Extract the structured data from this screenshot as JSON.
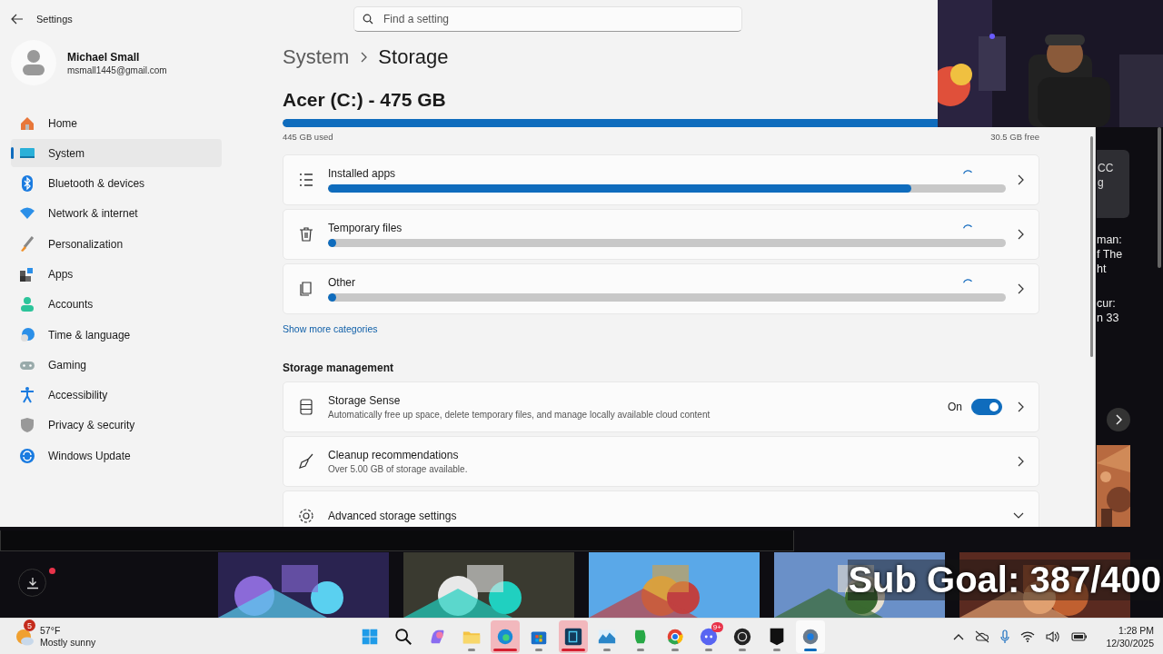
{
  "settings_window": {
    "title": "Settings",
    "search": {
      "placeholder": "Find a setting"
    },
    "account": {
      "name": "Michael Small",
      "email": "msmall1445@gmail.com"
    },
    "sidebar": {
      "items": [
        {
          "label": "Home",
          "selected": false
        },
        {
          "label": "System",
          "selected": true
        },
        {
          "label": "Bluetooth & devices",
          "selected": false
        },
        {
          "label": "Network & internet",
          "selected": false
        },
        {
          "label": "Personalization",
          "selected": false
        },
        {
          "label": "Apps",
          "selected": false
        },
        {
          "label": "Accounts",
          "selected": false
        },
        {
          "label": "Time & language",
          "selected": false
        },
        {
          "label": "Gaming",
          "selected": false
        },
        {
          "label": "Accessibility",
          "selected": false
        },
        {
          "label": "Privacy & security",
          "selected": false
        },
        {
          "label": "Windows Update",
          "selected": false
        }
      ]
    },
    "breadcrumb": [
      "System",
      "Storage"
    ],
    "drive": {
      "title": "Acer (C:) - 475 GB",
      "level": 0.937,
      "used": "445 GB used",
      "free": "30.5 GB free"
    },
    "categories": [
      {
        "label": "Installed apps",
        "level": 0.86
      },
      {
        "label": "Temporary files",
        "level": 0.012
      },
      {
        "label": "Other",
        "level": 0.012
      }
    ],
    "show_more": "Show more categories",
    "management": {
      "heading": "Storage management",
      "items": [
        {
          "kind": "toggle",
          "title": "Storage Sense",
          "subtitle": "Automatically free up space, delete temporary files, and manage locally available cloud content",
          "state_label": "On",
          "on": true
        },
        {
          "kind": "link",
          "title": "Cleanup recommendations",
          "subtitle": "Over 5.00 GB of storage available."
        },
        {
          "kind": "expander",
          "title": "Advanced storage settings"
        }
      ]
    }
  },
  "background_app": {
    "card_lines": [
      "CC",
      "g"
    ],
    "text_blocks": [
      {
        "lines": [
          "man:",
          "f The",
          "ht"
        ]
      },
      {
        "lines": [
          "cur:",
          "n 33"
        ]
      }
    ]
  },
  "overlay": {
    "sub_goal": "Sub Goal: 387/400"
  },
  "taskbar": {
    "weather": {
      "badge": "5",
      "temperature": "57°F",
      "condition": "Mostly sunny"
    },
    "apps": [
      {
        "running": false,
        "active": false,
        "highlighted": false
      },
      {
        "running": false,
        "active": false,
        "highlighted": false
      },
      {
        "running": false,
        "active": false,
        "highlighted": false
      },
      {
        "running": true,
        "active": false,
        "highlighted": false
      },
      {
        "running": true,
        "active": false,
        "highlighted": true
      },
      {
        "running": true,
        "active": false,
        "highlighted": false
      },
      {
        "running": true,
        "active": false,
        "highlighted": true
      },
      {
        "running": true,
        "active": false,
        "highlighted": false
      },
      {
        "running": true,
        "active": false,
        "highlighted": false
      },
      {
        "running": true,
        "active": false,
        "highlighted": false
      },
      {
        "running": true,
        "active": false,
        "highlighted": false,
        "badge": "9+"
      },
      {
        "running": true,
        "active": false,
        "highlighted": false
      },
      {
        "running": true,
        "active": false,
        "highlighted": false
      },
      {
        "running": true,
        "active": true,
        "highlighted": false
      }
    ],
    "clock": {
      "time": "1:28 PM",
      "date": "12/30/2025"
    }
  }
}
